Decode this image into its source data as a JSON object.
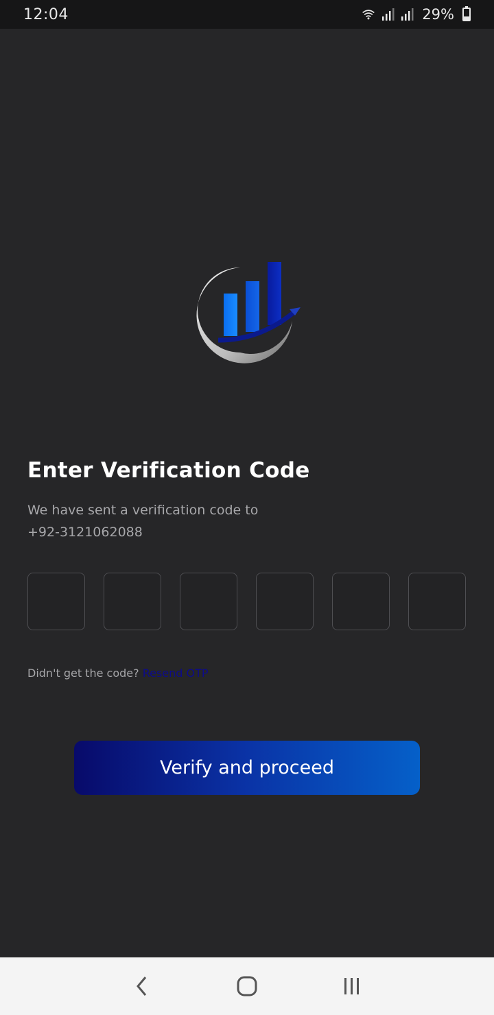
{
  "status_bar": {
    "time": "12:04",
    "battery_percent": "29%",
    "icons": [
      "wifi-icon",
      "signal-icon",
      "signal-icon",
      "battery-icon"
    ]
  },
  "logo": {
    "name": "app-logo"
  },
  "verification": {
    "title": "Enter Verification Code",
    "message": "We have sent a verification code to",
    "phone": "+92-3121062088",
    "otp_digits": [
      "",
      "",
      "",
      "",
      "",
      ""
    ],
    "resend_prompt": "Didn't get the code?",
    "resend_link": "Resend OTP",
    "verify_button": "Verify and proceed"
  },
  "nav_bar": {
    "items": [
      "back-icon",
      "home-icon",
      "recents-icon"
    ]
  },
  "colors": {
    "background": "#262628",
    "accent_dark": "#080a6a",
    "accent_light": "#0560c9",
    "resend_link": "#0d0b8a"
  }
}
